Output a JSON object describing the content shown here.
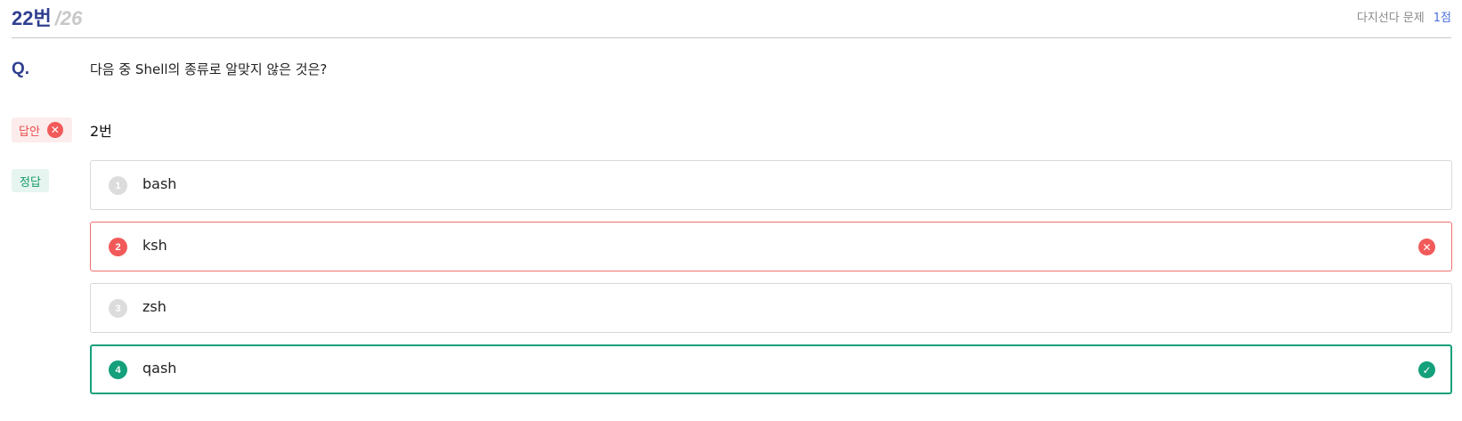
{
  "header": {
    "question_number": "22번",
    "question_total": "/26",
    "question_type": "다지선다 문제",
    "points": "1점"
  },
  "question": {
    "label": "Q.",
    "text": "다음 중 Shell의 종류로 알맞지 않은 것은?"
  },
  "answer": {
    "badge_label": "답안",
    "value": "2번",
    "status_icon": "x-circle-icon"
  },
  "correct": {
    "badge_label": "정답"
  },
  "options": [
    {
      "number": "1",
      "text": "bash",
      "state": "neutral"
    },
    {
      "number": "2",
      "text": "ksh",
      "state": "wrong",
      "status_icon": "x-circle-icon"
    },
    {
      "number": "3",
      "text": "zsh",
      "state": "neutral"
    },
    {
      "number": "4",
      "text": "qash",
      "state": "correct",
      "status_icon": "check-circle-icon"
    }
  ],
  "colors": {
    "accent_blue": "#2f3f8f",
    "wrong_red": "#f25a5a",
    "correct_green": "#13a07a",
    "link_blue": "#4a6fe0"
  }
}
